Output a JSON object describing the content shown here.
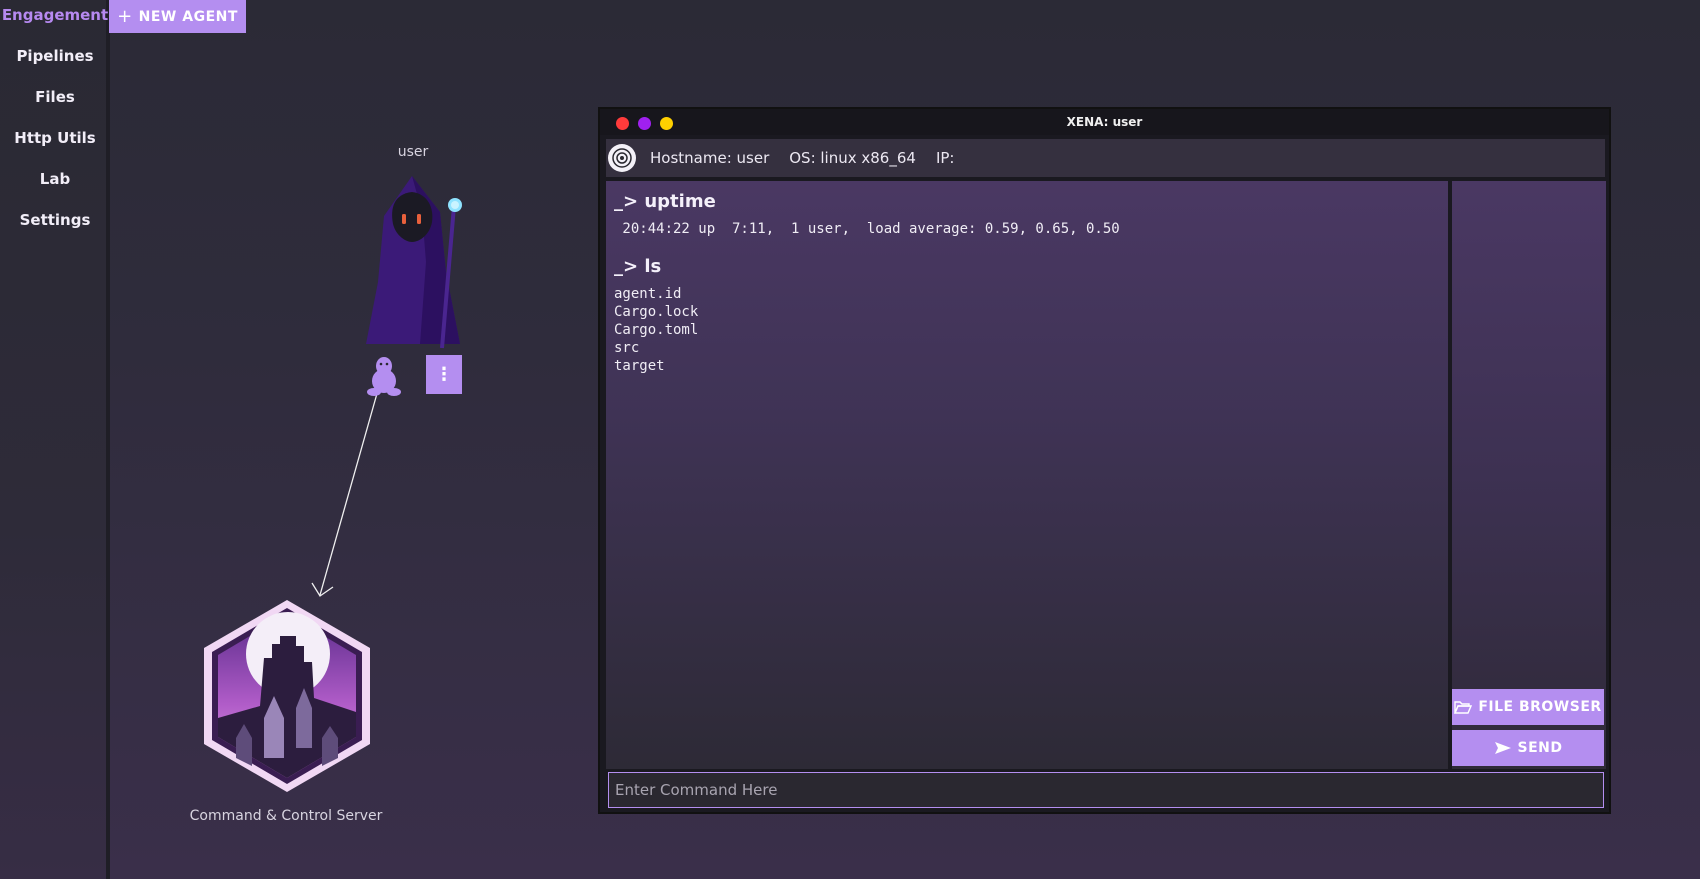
{
  "sidebar": {
    "items": [
      {
        "label": "Engagement",
        "active": true
      },
      {
        "label": "Pipelines"
      },
      {
        "label": "Files"
      },
      {
        "label": "Http Utils"
      },
      {
        "label": "Lab"
      },
      {
        "label": "Settings"
      }
    ]
  },
  "toolbar": {
    "new_agent_label": "NEW AGENT",
    "new_agent_icon": "plus-icon"
  },
  "canvas": {
    "agent": {
      "label": "user",
      "icon": "hooded-wizard-icon",
      "os_icon": "tux-icon"
    },
    "server": {
      "label": "Command & Control Server",
      "icon": "castle-emblem-icon"
    }
  },
  "terminal": {
    "title": "XENA: user",
    "hostname": "Hostname: user",
    "os": "OS: linux x86_64",
    "ip": "IP:",
    "commands": [
      {
        "cmd": "_> uptime",
        "output": " 20:44:22 up  7:11,  1 user,  load average: 0.59, 0.65, 0.50"
      },
      {
        "cmd": "_> ls",
        "output": "agent.id\nCargo.lock\nCargo.toml\nsrc\ntarget"
      }
    ],
    "file_browser_label": "FILE BROWSER",
    "send_label": "SEND",
    "input_placeholder": "Enter Command Here"
  },
  "colors": {
    "accent": "#b48ef0",
    "close": "#ff3b3b",
    "minimize": "#a020f0",
    "maximize": "#ffd000"
  }
}
